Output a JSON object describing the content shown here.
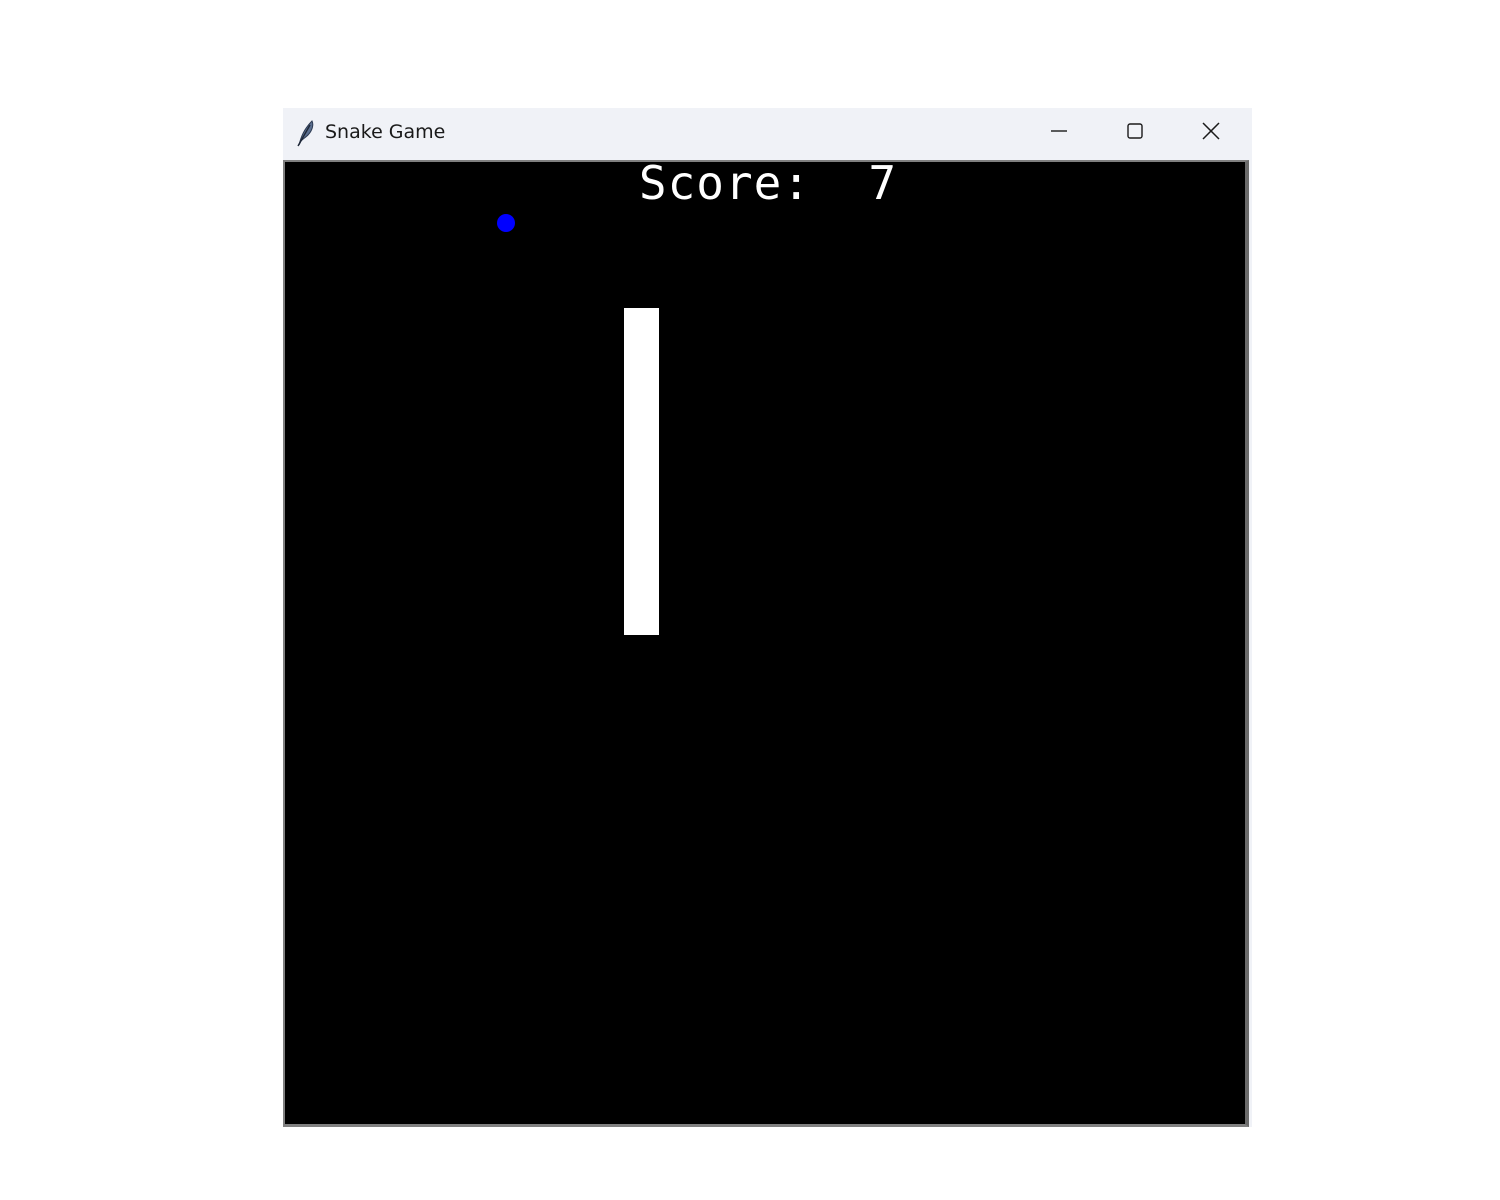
{
  "window": {
    "title": "Snake Game",
    "app_icon": "feather-icon",
    "controls": {
      "minimize_icon": "minimize-icon",
      "maximize_icon": "maximize-icon",
      "close_icon": "close-icon"
    }
  },
  "game": {
    "score_text": "Score:  7",
    "colors": {
      "background": "#000000",
      "snake": "#ffffff",
      "food": "#0000ff",
      "score": "#ffffff"
    }
  }
}
